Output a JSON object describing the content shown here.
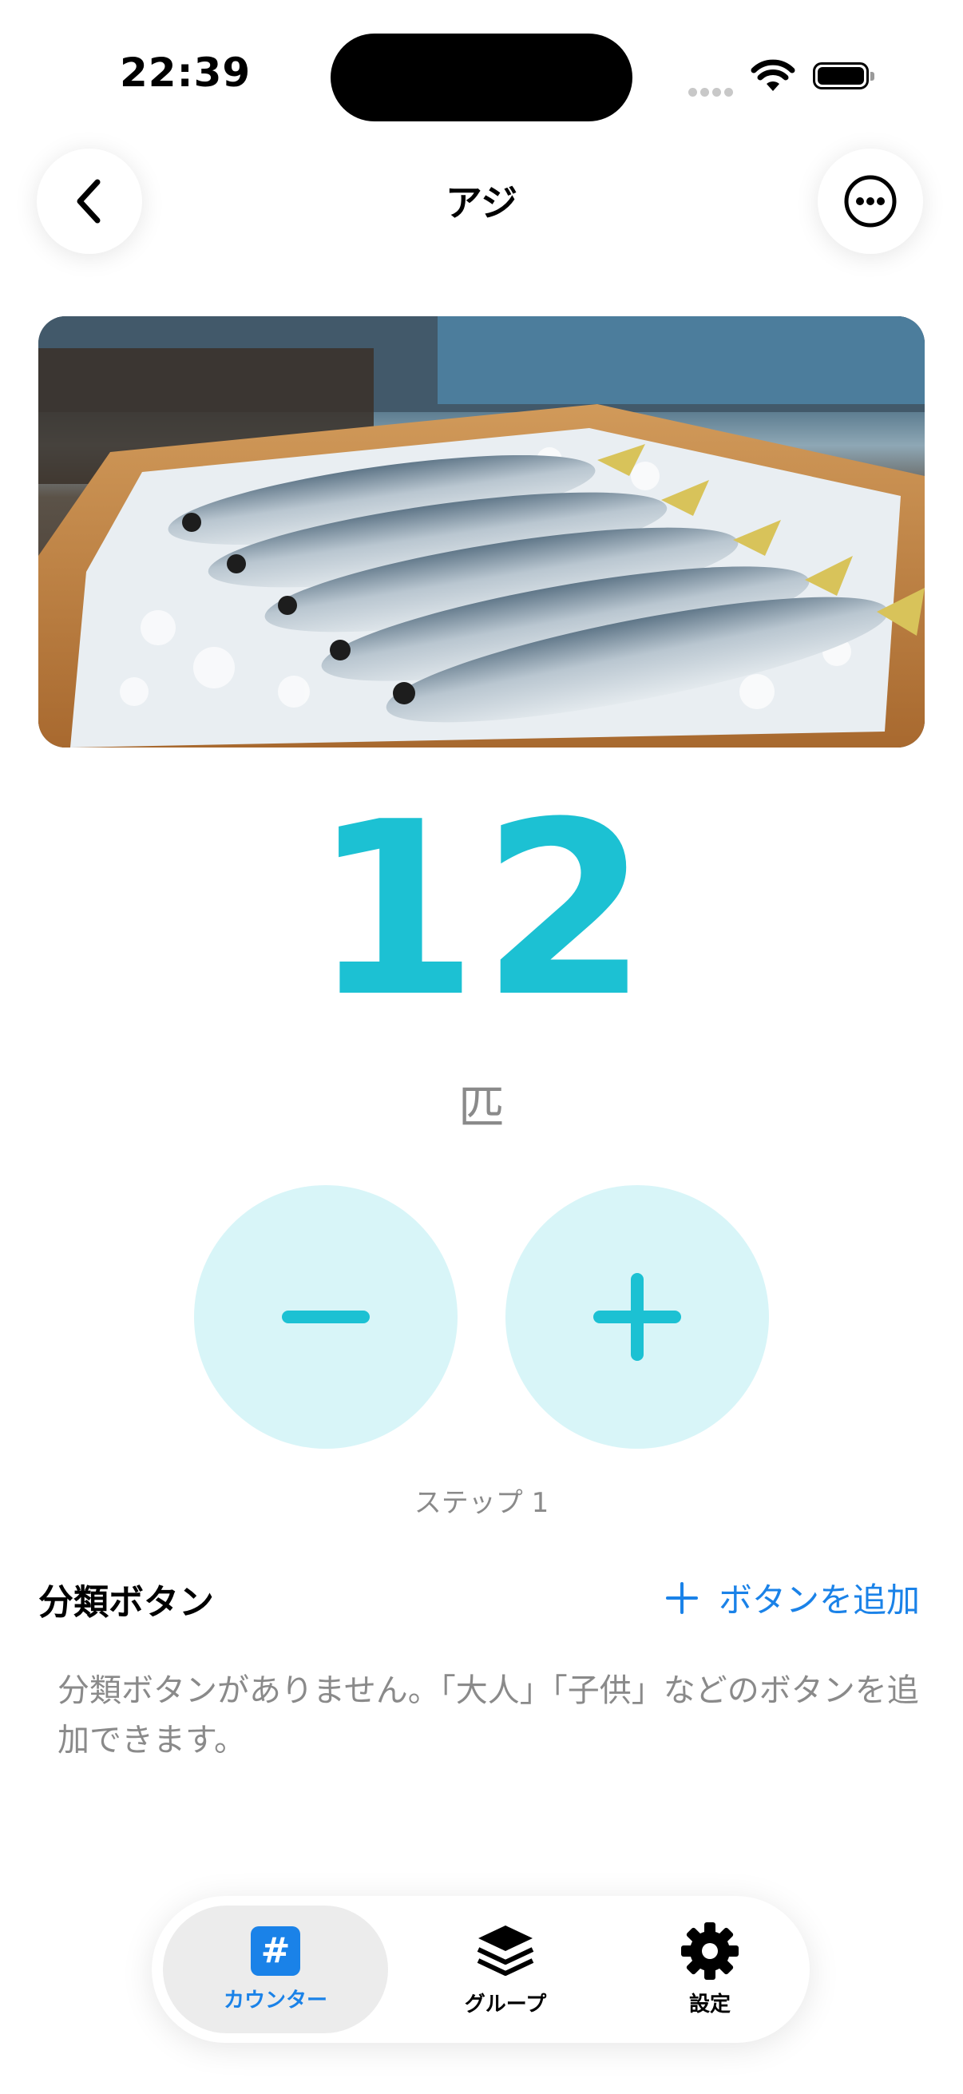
{
  "status_bar": {
    "time": "22:39"
  },
  "nav": {
    "title": "アジ",
    "back_icon": "chevron-left-icon",
    "more_icon": "ellipsis-circle-icon"
  },
  "hero": {
    "image": "fish-tray-photo"
  },
  "counter": {
    "value": "12",
    "unit": "匹",
    "step_label": "ステップ 1"
  },
  "classification": {
    "title": "分類ボタン",
    "add_label": "ボタンを追加",
    "empty_message": "分類ボタンがありません。「大人」「子供」などのボタンを追加できます。"
  },
  "tabbar": {
    "items": [
      {
        "label": "カウンター",
        "icon": "hash-icon",
        "active": true
      },
      {
        "label": "グループ",
        "icon": "layers-icon",
        "active": false
      },
      {
        "label": "設定",
        "icon": "gear-icon",
        "active": false
      }
    ]
  },
  "colors": {
    "accent": "#1cc1d3",
    "link": "#1a82e8",
    "button_bg": "#d8f5f8"
  }
}
